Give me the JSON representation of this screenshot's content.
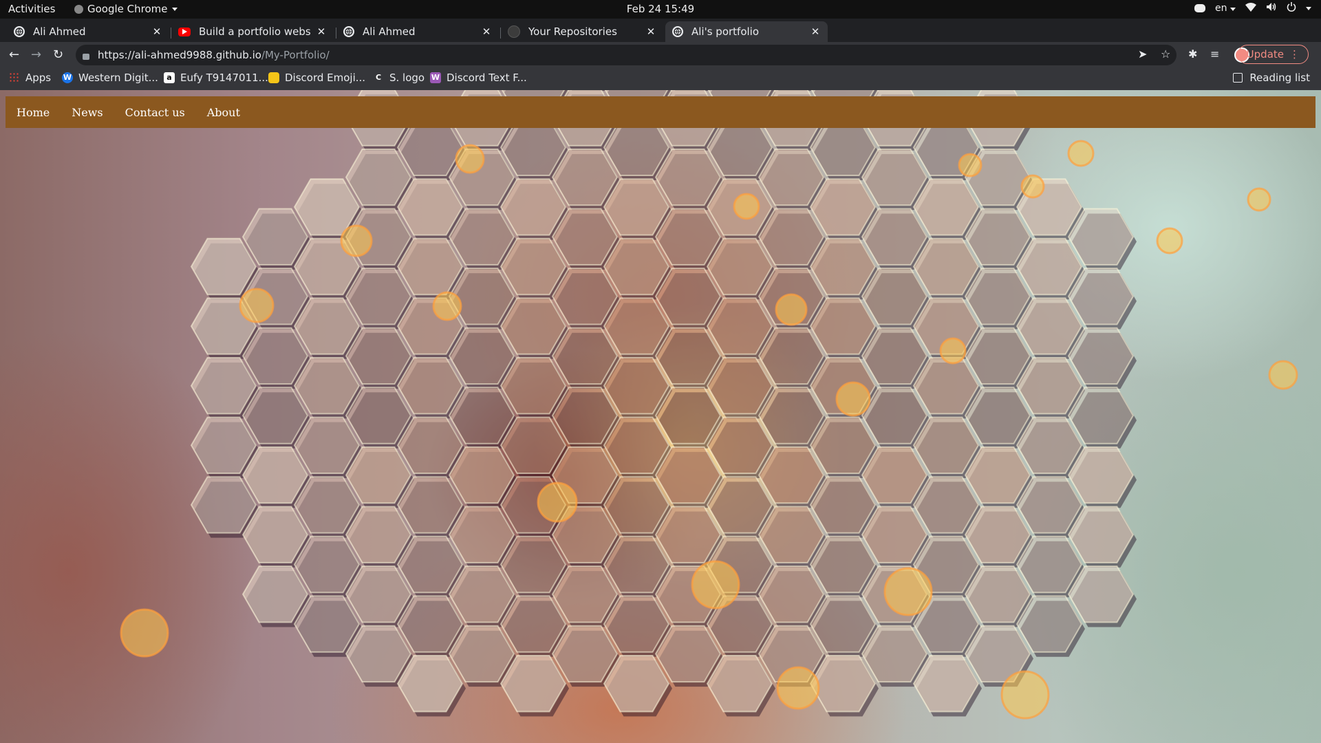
{
  "os": {
    "activities": "Activities",
    "app_menu": "Google Chrome",
    "clock": "Feb 24  15:49",
    "lang": "en"
  },
  "tabs": [
    {
      "title": "Ali Ahmed",
      "favicon": "globe-icon",
      "active": false
    },
    {
      "title": "Build a portfolio website",
      "favicon": "youtube-icon",
      "active": false
    },
    {
      "title": "Ali Ahmed",
      "favicon": "globe-icon",
      "active": false
    },
    {
      "title": "Your Repositories",
      "favicon": "github-icon",
      "active": false
    },
    {
      "title": "Ali's portfolio",
      "favicon": "globe-icon",
      "active": true
    }
  ],
  "omnibox": {
    "url_host": "https://ali-ahmed9988.github.io",
    "url_path": "/My-Portfolio/"
  },
  "toolbar": {
    "update_label": "Update"
  },
  "bookmarks": [
    {
      "label": "Apps",
      "icon": "apps-grid-icon"
    },
    {
      "label": "Western Digit...",
      "icon": "wd-icon"
    },
    {
      "label": "Eufy T9147011...",
      "icon": "amazon-icon"
    },
    {
      "label": "Discord Emoji...",
      "icon": "emoji-icon"
    },
    {
      "label": "S. logo",
      "icon": "c-icon"
    },
    {
      "label": "Discord Text F...",
      "icon": "discord-text-icon"
    }
  ],
  "reading_list": "Reading list",
  "site": {
    "nav": [
      {
        "label": "Home"
      },
      {
        "label": "News"
      },
      {
        "label": "Contact us"
      },
      {
        "label": "About"
      }
    ],
    "nav_color": "#8b581f"
  }
}
